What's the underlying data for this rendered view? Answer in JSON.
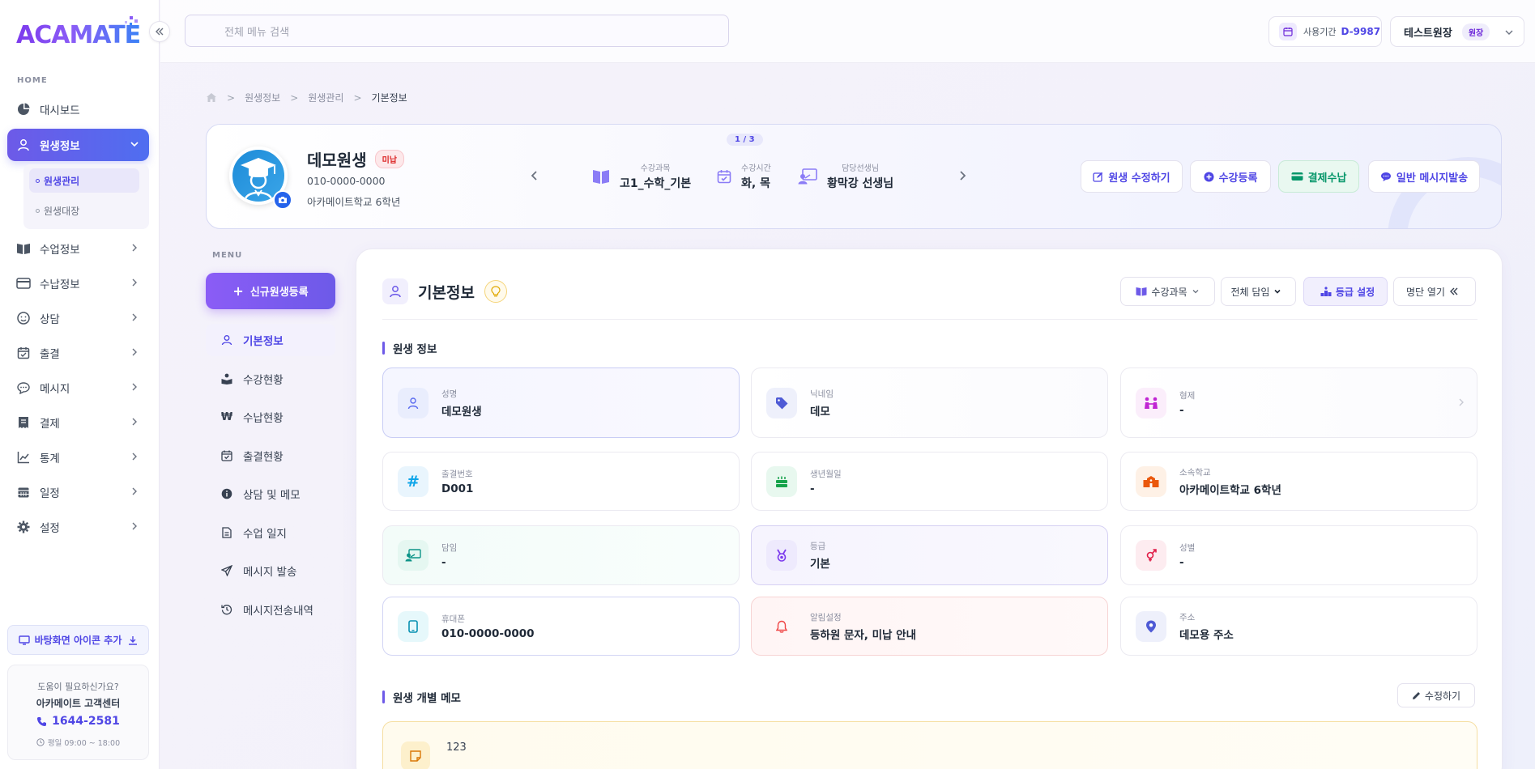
{
  "app": {
    "logo_text": "ACAMATE"
  },
  "sidebar": {
    "section_home": "HOME",
    "items": [
      {
        "label": "대시보드",
        "icon": "pie-chart-icon"
      },
      {
        "label": "원생정보",
        "icon": "user-icon"
      },
      {
        "label": "수업정보",
        "icon": "book-icon"
      },
      {
        "label": "수납정보",
        "icon": "credit-card-icon"
      },
      {
        "label": "상담",
        "icon": "smile-icon"
      },
      {
        "label": "출결",
        "icon": "calendar-check-icon"
      },
      {
        "label": "메시지",
        "icon": "chat-icon"
      },
      {
        "label": "결제",
        "icon": "receipt-icon"
      },
      {
        "label": "통계",
        "icon": "line-chart-icon"
      },
      {
        "label": "일정",
        "icon": "calendar-icon"
      },
      {
        "label": "설정",
        "icon": "gear-icon"
      }
    ],
    "subitems": [
      {
        "label": "원생관리"
      },
      {
        "label": "원생대장"
      }
    ],
    "desktop_button": "바탕화면 아이콘 추가",
    "help": {
      "question": "도움이 필요하신가요?",
      "center": "아카메이트 고객센터",
      "phone": "1644-2581",
      "hours": "평일 09:00 ~ 18:00"
    }
  },
  "topbar": {
    "search_placeholder": "전체 메뉴 검색",
    "period_label": "사용기간",
    "period_value": "D-9987",
    "user_name": "테스트원장",
    "user_role": "원장"
  },
  "breadcrumb": [
    "원생정보",
    "원생관리",
    "기본정보"
  ],
  "profile": {
    "name": "데모원생",
    "status_badge": "미납",
    "phone": "010-0000-0000",
    "school": "아카메이트학교 6학년",
    "pager": "1 / 3",
    "info": [
      {
        "label": "수강과목",
        "value": "고1_수학_기본"
      },
      {
        "label": "수강시간",
        "value": "화, 목"
      },
      {
        "label": "담당선생님",
        "value": "황막강 선생님"
      }
    ],
    "buttons": {
      "edit": "원생 수정하기",
      "enroll": "수강등록",
      "pay": "결제수납",
      "message": "일반 메시지발송"
    }
  },
  "menu": {
    "label": "MENU",
    "new_button": "신규원생등록",
    "items": [
      {
        "label": "기본정보"
      },
      {
        "label": "수강현황"
      },
      {
        "label": "수납현황"
      },
      {
        "label": "출결현황"
      },
      {
        "label": "상담 및 메모"
      },
      {
        "label": "수업 일지"
      },
      {
        "label": "메시지 발송"
      },
      {
        "label": "메시지전송내역"
      }
    ]
  },
  "main": {
    "title": "기본정보",
    "tools": {
      "course": "수강과목",
      "class": "전체 담임",
      "grade": "등급 설정",
      "roster": "명단 열기"
    },
    "section_info": "원생 정보",
    "fields": [
      {
        "label": "성명",
        "value": "데모원생"
      },
      {
        "label": "닉네임",
        "value": "데모"
      },
      {
        "label": "형제",
        "value": "-"
      },
      {
        "label": "출결번호",
        "value": "D001"
      },
      {
        "label": "생년월일",
        "value": "-"
      },
      {
        "label": "소속학교",
        "value": "아카메이트학교 6학년"
      },
      {
        "label": "담임",
        "value": "-"
      },
      {
        "label": "등급",
        "value": "기본"
      },
      {
        "label": "성별",
        "value": "-"
      },
      {
        "label": "휴대폰",
        "value": "010-0000-0000"
      },
      {
        "label": "알림설정",
        "value": "등하원 문자, 미납 안내"
      },
      {
        "label": "주소",
        "value": "데모용 주소"
      }
    ],
    "section_memo": "원생 개별 메모",
    "memo_edit": "수정하기",
    "memo_text": "123"
  },
  "colors": {
    "accent": "#6d5ae8",
    "primary_blue": "#4f46e5",
    "unpaid_red": "#dc2626",
    "pay_green": "#059669"
  }
}
